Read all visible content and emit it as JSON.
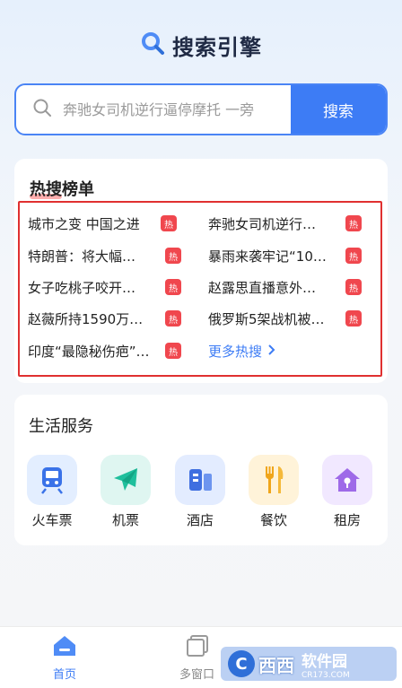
{
  "header": {
    "title": "搜索引擎",
    "icon": "search-icon"
  },
  "search": {
    "placeholder": "奔驰女司机逆行逼停摩托 一旁",
    "button_label": "搜索"
  },
  "hot": {
    "title": "热搜榜单",
    "badge": "热",
    "items": [
      {
        "text": "城市之变 中国之进"
      },
      {
        "text": "奔驰女司机逆行…"
      },
      {
        "text": "特朗普：将大幅…"
      },
      {
        "text": "暴雨来袭牢记“10…"
      },
      {
        "text": "女子吃桃子咬开…"
      },
      {
        "text": "赵露思直播意外…"
      },
      {
        "text": "赵薇所持1590万…"
      },
      {
        "text": "俄罗斯5架战机被…"
      },
      {
        "text": "印度“最隐秘伤疤”…"
      }
    ],
    "more_label": "更多热搜"
  },
  "life": {
    "title": "生活服务",
    "services": [
      {
        "label": "火车票",
        "icon": "train-icon",
        "bg": "#e3eeff",
        "color": "#3a72e8"
      },
      {
        "label": "机票",
        "icon": "airplane-icon",
        "bg": "#dff6f1",
        "color": "#1fbf9c"
      },
      {
        "label": "酒店",
        "icon": "hotel-icon",
        "bg": "#e3ecff",
        "color": "#3f6fe0"
      },
      {
        "label": "餐饮",
        "icon": "dining-icon",
        "bg": "#fff3d9",
        "color": "#f0a51a"
      },
      {
        "label": "租房",
        "icon": "house-icon",
        "bg": "#f1e8ff",
        "color": "#9e6ae8"
      }
    ]
  },
  "tabbar": {
    "tabs": [
      {
        "label": "首页",
        "icon": "home-icon",
        "active": true
      },
      {
        "label": "多窗口",
        "icon": "windows-icon",
        "active": false
      }
    ]
  },
  "watermark": {
    "logo": "C",
    "text": "西西",
    "site": "软件园",
    "url": "CR173.COM"
  },
  "colors": {
    "accent": "#3d7cf5",
    "hot_badge": "#f0474e",
    "highlight_box": "#e03030"
  }
}
